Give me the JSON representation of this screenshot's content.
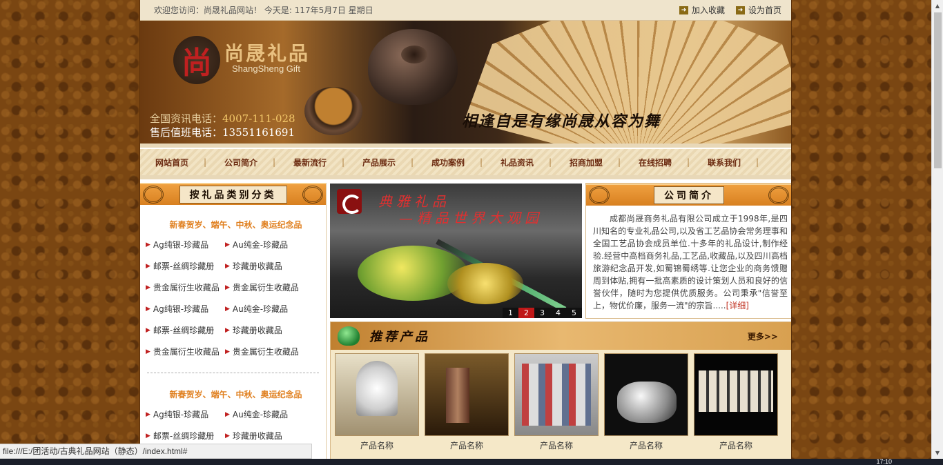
{
  "topbar": {
    "welcome": "欢迎您访问：尚晟礼品网站！ 今天是:   117年5月7日    星期日",
    "bookmark": "加入收藏",
    "homepage": "设为首页"
  },
  "banner": {
    "logo_mark": "尚",
    "logo_cn": "尚晟礼品",
    "logo_en": "ShangSheng Gift",
    "hotline_label": "全国资讯电话：",
    "hotline": "4007-111-028",
    "service_label": "售后值班电话：",
    "service": "13551161691",
    "slogan": "相逢自是有缘尚晟从容为舞"
  },
  "nav": [
    "网站首页",
    "公司简介",
    "最新流行",
    "产品展示",
    "成功案例",
    "礼品资讯",
    "招商加盟",
    "在线招聘",
    "联系我们"
  ],
  "category": {
    "title": "按礼品类别分类",
    "groups": [
      {
        "head": "新春贺岁、端午、中秋、奥运纪念品",
        "items": [
          "Ag纯银-珍藏品",
          "Au纯金-珍藏品",
          "邮票-丝绸珍藏册",
          "珍藏册收藏品",
          "贵金属衍生收藏品",
          "贵金属衍生收藏品",
          "Ag纯银-珍藏品",
          "Au纯金-珍藏品",
          "邮票-丝绸珍藏册",
          "珍藏册收藏品",
          "贵金属衍生收藏品",
          "贵金属衍生收藏品"
        ]
      },
      {
        "head": "新春贺岁、端午、中秋、奥运纪念品",
        "items": [
          "Ag纯银-珍藏品",
          "Au纯金-珍藏品",
          "邮票-丝绸珍藏册",
          "珍藏册收藏品"
        ]
      }
    ]
  },
  "slider": {
    "title1": "典雅礼品",
    "title2": "—精品世界大观园",
    "pages": [
      "1",
      "2",
      "3",
      "4",
      "5"
    ],
    "active": 1
  },
  "about": {
    "title": "公司简介",
    "text": "成都尚晟商务礼品有限公司成立于1998年,是四川知名的专业礼品公司,以及省工艺品协会常务理事和全国工艺品协会成员单位.十多年的礼品设计,制作经验.经营中高档商务礼品,工艺品,收藏品,以及四川高档旅游纪念品开发,如蜀锦蜀绣等.让您企业的商务馈赠周到体贴,拥有一批高素质的设计策划人员和良好的信誉伙伴，随时为您提供优质服务。公司秉承\"信誉至上，物优价廉，服务一流\"的宗旨.....",
    "more": "[详细]"
  },
  "recommend": {
    "title": "推荐产品",
    "more": "更多>>",
    "products": [
      "产品名称",
      "产品名称",
      "产品名称",
      "产品名称",
      "产品名称"
    ]
  },
  "status": "file:///E:/团活动/古典礼品网站（静态）/index.html#",
  "clock": "17:10"
}
